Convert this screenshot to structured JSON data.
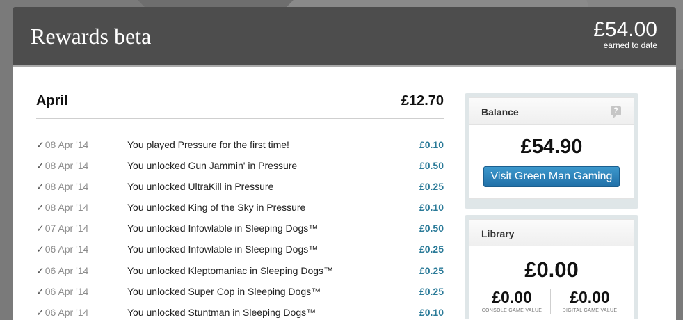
{
  "header": {
    "title": "Rewards beta",
    "earned_amount": "£54.00",
    "earned_caption": "earned to date"
  },
  "month": {
    "name": "April",
    "total": "£12.70"
  },
  "activity": [
    {
      "tick": "✓",
      "date": "08 Apr '14",
      "text": "You played Pressure for the first time!",
      "amount": "£0.10"
    },
    {
      "tick": "✓",
      "date": "08 Apr '14",
      "text": "You unlocked Gun Jammin' in Pressure",
      "amount": "£0.50"
    },
    {
      "tick": "✓",
      "date": "08 Apr '14",
      "text": "You unlocked UltraKill in Pressure",
      "amount": "£0.25"
    },
    {
      "tick": "✓",
      "date": "08 Apr '14",
      "text": "You unlocked King of the Sky in Pressure",
      "amount": "£0.10"
    },
    {
      "tick": "✓",
      "date": "07 Apr '14",
      "text": "You unlocked Infowlable in Sleeping Dogs™",
      "amount": "£0.50"
    },
    {
      "tick": "✓",
      "date": "06 Apr '14",
      "text": "You unlocked Infowlable in Sleeping Dogs™",
      "amount": "£0.25"
    },
    {
      "tick": "✓",
      "date": "06 Apr '14",
      "text": "You unlocked Kleptomaniac in Sleeping Dogs™",
      "amount": "£0.25"
    },
    {
      "tick": "✓",
      "date": "06 Apr '14",
      "text": "You unlocked Super Cop in Sleeping Dogs™",
      "amount": "£0.25"
    },
    {
      "tick": "✓",
      "date": "06 Apr '14",
      "text": "You unlocked Stuntman in Sleeping Dogs™",
      "amount": "£0.10"
    }
  ],
  "balance": {
    "title": "Balance",
    "help_icon": "?",
    "value": "£54.90",
    "button_label": "Visit Green Man Gaming"
  },
  "library": {
    "title": "Library",
    "value": "£0.00",
    "console_value": "£0.00",
    "console_caption": "CONSOLE GAME VALUE",
    "digital_value": "£0.00",
    "digital_caption": "DIGITAL GAME VALUE"
  },
  "colors": {
    "header_bg": "#4d4d4d",
    "amount_accent": "#2a7a98",
    "button_bg": "#2a80b9"
  }
}
